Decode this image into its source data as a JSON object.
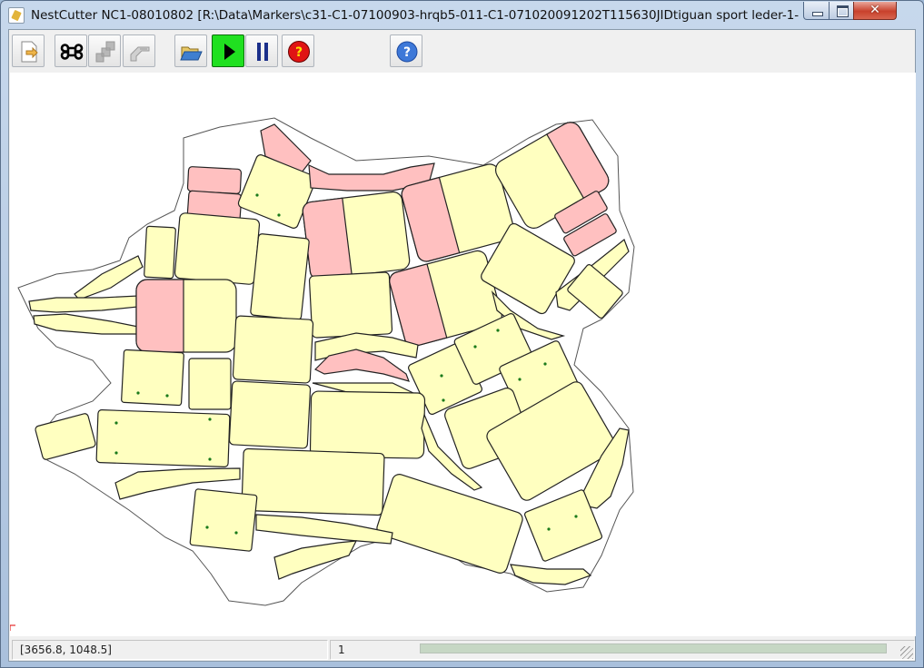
{
  "window": {
    "title": "NestCutter NC1-08010802 [R:\\Data\\Markers\\c31-C1-07100903-hrqb5-011-C1-071020091202T115630JIDtiguan sport leder-1-1..."
  },
  "toolbar": {
    "buttons": [
      {
        "name": "new-file",
        "icon": "document-arrow-icon"
      },
      {
        "name": "command",
        "icon": "command-key-icon"
      },
      {
        "name": "pieces",
        "icon": "pieces-icon"
      },
      {
        "name": "cutter",
        "icon": "cutter-icon"
      },
      {
        "name": "open-folder",
        "icon": "folder-open-icon"
      },
      {
        "name": "start",
        "icon": "play-icon"
      },
      {
        "name": "pause",
        "icon": "pause-icon"
      },
      {
        "name": "stop-help",
        "icon": "question-red-icon"
      },
      {
        "name": "help",
        "icon": "question-blue-icon"
      }
    ]
  },
  "colors": {
    "piece_fill": "#ffffc0",
    "piece_marked": "#ffc0c0",
    "outline": "#555555",
    "play_bg": "#20e020"
  },
  "status": {
    "coordinates": "[3656.8, 1048.5]",
    "count": "1",
    "progress_fraction": 1.0
  }
}
